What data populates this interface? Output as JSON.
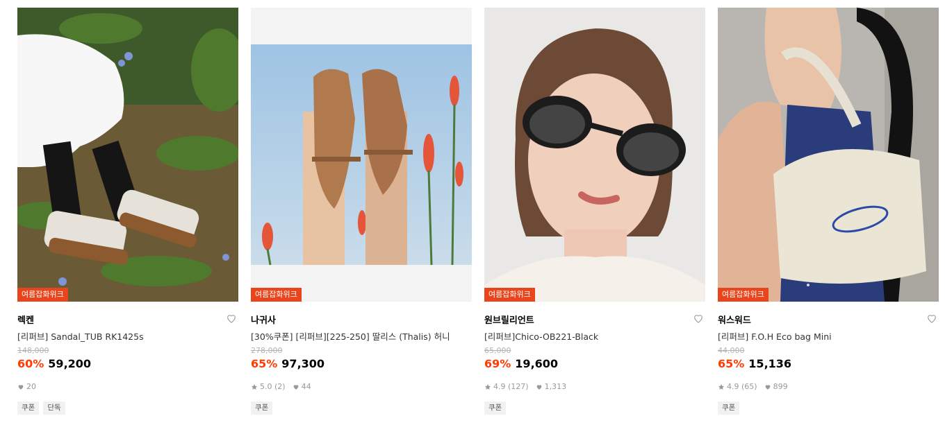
{
  "products": [
    {
      "badge": "여름잡화위크",
      "brand": "렉켄",
      "name": "[리퍼브] Sandal_TUB RK1425s",
      "original_price": "148,000",
      "discount": "60%",
      "price": "59,200",
      "rating": "",
      "likes": "20",
      "tags": [
        "쿠폰",
        "단독"
      ],
      "image": "white-sandals-black-socks-on-grass"
    },
    {
      "badge": "여름잡화위크",
      "brand": "나귀사",
      "name": "[30%쿠폰] [리퍼브][225-250] 딸리스 (Thalis) 허니",
      "original_price": "278,000",
      "discount": "65%",
      "price": "97,300",
      "rating": "5.0 (2)",
      "likes": "44",
      "tags": [
        "쿠폰"
      ],
      "image": "tan-leather-sandals-against-sky"
    },
    {
      "badge": "여름잡화위크",
      "brand": "원브릴리언트",
      "name": "[리퍼브]Chico-OB221-Black",
      "original_price": "65,000",
      "discount": "69%",
      "price": "19,600",
      "rating": "4.9 (127)",
      "likes": "1,313",
      "tags": [
        "쿠폰"
      ],
      "image": "woman-wearing-black-sunglasses"
    },
    {
      "badge": "여름잡화위크",
      "brand": "워스워드",
      "name": "[리퍼브] F.O.H Eco bag Mini",
      "original_price": "44,000",
      "discount": "65%",
      "price": "15,136",
      "rating": "4.9 (65)",
      "likes": "899",
      "tags": [
        "쿠폰"
      ],
      "image": "woman-with-canvas-eco-bag"
    }
  ],
  "colors": {
    "badge": "#e8451c",
    "discount": "#ff3c00"
  },
  "icons": {
    "like": "heart-outline-icon",
    "star": "star-icon",
    "likes_count": "heart-filled-icon"
  }
}
